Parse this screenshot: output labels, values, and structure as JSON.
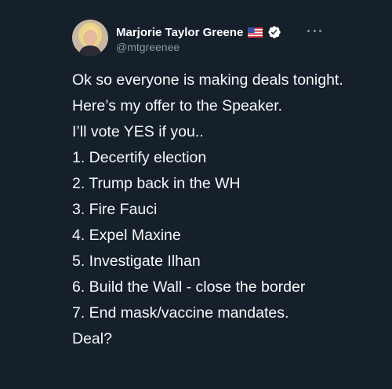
{
  "author": {
    "name": "Marjorie Taylor Greene",
    "handle": "@mtgreenee",
    "flag_icon": "us-flag-icon",
    "verified_icon": "verified-badge-icon",
    "avatar_icon": "avatar-photo"
  },
  "menu": {
    "icon": "more-options-icon"
  },
  "tweet": {
    "paragraphs": [
      "Ok so everyone is making deals tonight.",
      "Here’s my offer to the Speaker.",
      "I’ll vote YES if you..",
      "1. Decertify election",
      "2. Trump back in the WH",
      "3. Fire Fauci",
      "4. Expel Maxine",
      "5. Investigate Ilhan",
      "6. Build the Wall - close the border",
      "7. End mask/vaccine mandates.",
      "Deal?"
    ]
  },
  "colors": {
    "background": "#15202b",
    "text_primary": "#f7f9f9",
    "text_secondary": "#8b98a5"
  }
}
